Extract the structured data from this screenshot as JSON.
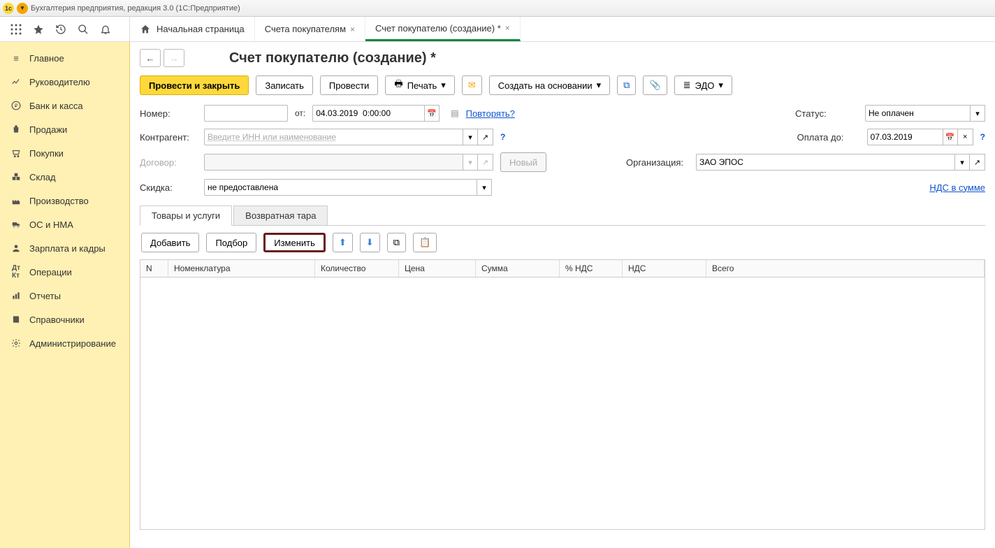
{
  "titlebar": {
    "text": "Бухгалтерия предприятия, редакция 3.0   (1С:Предприятие)"
  },
  "tabs": {
    "home": "Начальная страница",
    "tab1": "Счета покупателям",
    "tab2": "Счет покупателю (создание) *"
  },
  "sidebar": {
    "items": [
      "Главное",
      "Руководителю",
      "Банк и касса",
      "Продажи",
      "Покупки",
      "Склад",
      "Производство",
      "ОС и НМА",
      "Зарплата и кадры",
      "Операции",
      "Отчеты",
      "Справочники",
      "Администрирование"
    ]
  },
  "page": {
    "title": "Счет покупателю (создание) *"
  },
  "cmdbar": {
    "post_close": "Провести и закрыть",
    "save": "Записать",
    "post": "Провести",
    "print": "Печать",
    "create_based": "Создать на основании",
    "edo": "ЭДО"
  },
  "form": {
    "number_label": "Номер:",
    "number_value": "",
    "from_label": "от:",
    "date_value": "04.03.2019  0:00:00",
    "repeat_link": "Повторять?",
    "status_label": "Статус:",
    "status_value": "Не оплачен",
    "counterparty_label": "Контрагент:",
    "counterparty_placeholder": "Введите ИНН или наименование",
    "payment_label": "Оплата до:",
    "payment_value": "07.03.2019",
    "contract_label": "Договор:",
    "new_btn": "Новый",
    "org_label": "Организация:",
    "org_value": "ЗАО ЭПОС",
    "discount_label": "Скидка:",
    "discount_value": "не предоставлена",
    "vat_link": "НДС в сумме"
  },
  "doc_tabs": {
    "tab1": "Товары и услуги",
    "tab2": "Возвратная тара"
  },
  "table_toolbar": {
    "add": "Добавить",
    "select": "Подбор",
    "change": "Изменить"
  },
  "grid": {
    "cols": [
      "N",
      "Номенклатура",
      "Количество",
      "Цена",
      "Сумма",
      "% НДС",
      "НДС",
      "Всего"
    ]
  }
}
